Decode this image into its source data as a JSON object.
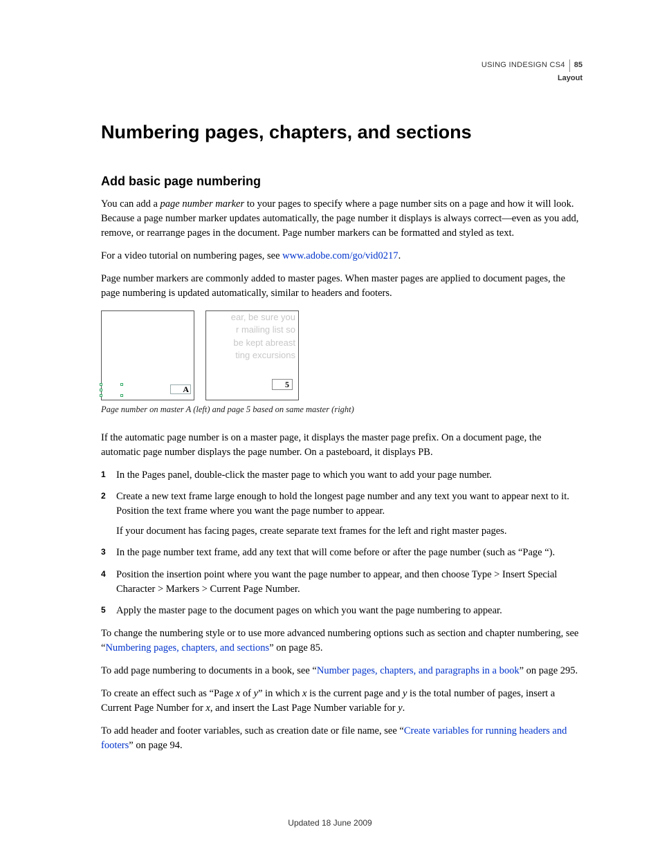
{
  "header": {
    "doc_name": "USING INDESIGN CS4",
    "page_number": "85",
    "section": "Layout"
  },
  "title": "Numbering pages, chapters, and sections",
  "subtitle": "Add basic page numbering",
  "intro": {
    "p1_a": "You can add a ",
    "p1_em": "page number marker",
    "p1_b": " to your pages to specify where a page number sits on a page and how it will look. Because a page number marker updates automatically, the page number it displays is always correct—even as you add, remove, or rearrange pages in the document. Page number markers can be formatted and styled as text.",
    "p2_a": "For a video tutorial on numbering pages, see ",
    "p2_link": "www.adobe.com/go/vid0217",
    "p2_b": ".",
    "p3": "Page number markers are commonly added to master pages. When master pages are applied to document pages, the page numbering is updated automatically, similar to headers and footers."
  },
  "figure": {
    "master_label": "A",
    "page_label": "5",
    "greeked": "ear, be sure you\nr mailing list so\nbe kept abreast\nting excursions",
    "caption": "Page number on master A (left) and page 5 based on same master (right)"
  },
  "after_fig": "If the automatic page number is on a master page, it displays the master page prefix. On a document page, the automatic page number displays the page number. On a pasteboard, it displays PB.",
  "steps": {
    "s1": "In the Pages panel, double-click the master page to which you want to add your page number.",
    "s2a": "Create a new text frame large enough to hold the longest page number and any text you want to appear next to it. Position the text frame where you want the page number to appear.",
    "s2b": "If your document has facing pages, create separate text frames for the left and right master pages.",
    "s3": "In the page number text frame, add any text that will come before or after the page number (such as “Page “).",
    "s4": "Position the insertion point where you want the page number to appear, and then choose Type > Insert Special Character > Markers > Current Page Number.",
    "s5": "Apply the master page to the document pages on which you want the page numbering to appear."
  },
  "tail": {
    "p1_a": "To change the numbering style or to use more advanced numbering options such as section and chapter numbering, see “",
    "p1_link": "Numbering pages, chapters, and sections",
    "p1_b": "” on page 85.",
    "p2_a": "To add page numbering to documents in a book, see “",
    "p2_link": "Number pages, chapters, and paragraphs in a book",
    "p2_b": "” on page 295.",
    "p3_a": "To create an effect such as “Page ",
    "p3_x1": "x",
    "p3_b": " of ",
    "p3_y1": "y",
    "p3_c": "” in which ",
    "p3_x2": "x",
    "p3_d": " is the current page and ",
    "p3_y2": "y",
    "p3_e": " is the total number of pages, insert a Current Page Number for ",
    "p3_x3": "x",
    "p3_f": ", and insert the Last Page Number variable for ",
    "p3_y3": "y",
    "p3_g": ".",
    "p4_a": "To add header and footer variables, such as creation date or file name, see “",
    "p4_link": "Create variables for running headers and footers",
    "p4_b": "” on page 94."
  },
  "footer": "Updated 18 June 2009"
}
